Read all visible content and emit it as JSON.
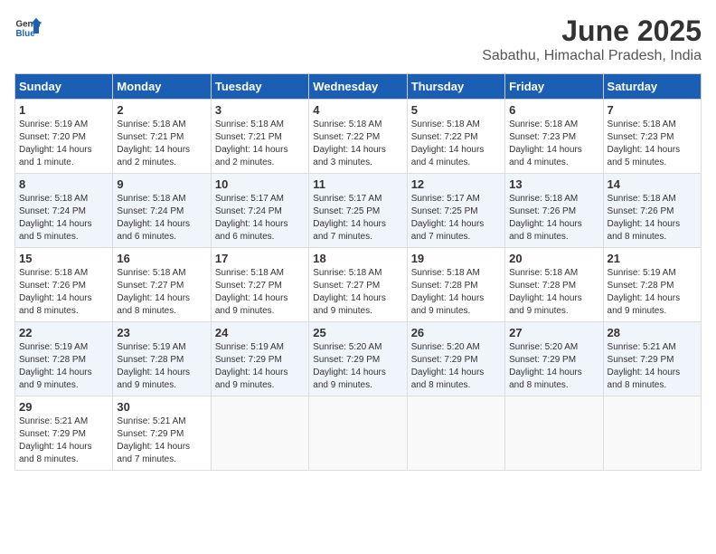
{
  "header": {
    "logo_general": "General",
    "logo_blue": "Blue",
    "month_title": "June 2025",
    "subtitle": "Sabathu, Himachal Pradesh, India"
  },
  "days_of_week": [
    "Sunday",
    "Monday",
    "Tuesday",
    "Wednesday",
    "Thursday",
    "Friday",
    "Saturday"
  ],
  "weeks": [
    [
      {
        "day": "1",
        "sunrise": "Sunrise: 5:19 AM",
        "sunset": "Sunset: 7:20 PM",
        "daylight": "Daylight: 14 hours and 1 minute."
      },
      {
        "day": "2",
        "sunrise": "Sunrise: 5:18 AM",
        "sunset": "Sunset: 7:21 PM",
        "daylight": "Daylight: 14 hours and 2 minutes."
      },
      {
        "day": "3",
        "sunrise": "Sunrise: 5:18 AM",
        "sunset": "Sunset: 7:21 PM",
        "daylight": "Daylight: 14 hours and 2 minutes."
      },
      {
        "day": "4",
        "sunrise": "Sunrise: 5:18 AM",
        "sunset": "Sunset: 7:22 PM",
        "daylight": "Daylight: 14 hours and 3 minutes."
      },
      {
        "day": "5",
        "sunrise": "Sunrise: 5:18 AM",
        "sunset": "Sunset: 7:22 PM",
        "daylight": "Daylight: 14 hours and 4 minutes."
      },
      {
        "day": "6",
        "sunrise": "Sunrise: 5:18 AM",
        "sunset": "Sunset: 7:23 PM",
        "daylight": "Daylight: 14 hours and 4 minutes."
      },
      {
        "day": "7",
        "sunrise": "Sunrise: 5:18 AM",
        "sunset": "Sunset: 7:23 PM",
        "daylight": "Daylight: 14 hours and 5 minutes."
      }
    ],
    [
      {
        "day": "8",
        "sunrise": "Sunrise: 5:18 AM",
        "sunset": "Sunset: 7:24 PM",
        "daylight": "Daylight: 14 hours and 5 minutes."
      },
      {
        "day": "9",
        "sunrise": "Sunrise: 5:18 AM",
        "sunset": "Sunset: 7:24 PM",
        "daylight": "Daylight: 14 hours and 6 minutes."
      },
      {
        "day": "10",
        "sunrise": "Sunrise: 5:17 AM",
        "sunset": "Sunset: 7:24 PM",
        "daylight": "Daylight: 14 hours and 6 minutes."
      },
      {
        "day": "11",
        "sunrise": "Sunrise: 5:17 AM",
        "sunset": "Sunset: 7:25 PM",
        "daylight": "Daylight: 14 hours and 7 minutes."
      },
      {
        "day": "12",
        "sunrise": "Sunrise: 5:17 AM",
        "sunset": "Sunset: 7:25 PM",
        "daylight": "Daylight: 14 hours and 7 minutes."
      },
      {
        "day": "13",
        "sunrise": "Sunrise: 5:18 AM",
        "sunset": "Sunset: 7:26 PM",
        "daylight": "Daylight: 14 hours and 8 minutes."
      },
      {
        "day": "14",
        "sunrise": "Sunrise: 5:18 AM",
        "sunset": "Sunset: 7:26 PM",
        "daylight": "Daylight: 14 hours and 8 minutes."
      }
    ],
    [
      {
        "day": "15",
        "sunrise": "Sunrise: 5:18 AM",
        "sunset": "Sunset: 7:26 PM",
        "daylight": "Daylight: 14 hours and 8 minutes."
      },
      {
        "day": "16",
        "sunrise": "Sunrise: 5:18 AM",
        "sunset": "Sunset: 7:27 PM",
        "daylight": "Daylight: 14 hours and 8 minutes."
      },
      {
        "day": "17",
        "sunrise": "Sunrise: 5:18 AM",
        "sunset": "Sunset: 7:27 PM",
        "daylight": "Daylight: 14 hours and 9 minutes."
      },
      {
        "day": "18",
        "sunrise": "Sunrise: 5:18 AM",
        "sunset": "Sunset: 7:27 PM",
        "daylight": "Daylight: 14 hours and 9 minutes."
      },
      {
        "day": "19",
        "sunrise": "Sunrise: 5:18 AM",
        "sunset": "Sunset: 7:28 PM",
        "daylight": "Daylight: 14 hours and 9 minutes."
      },
      {
        "day": "20",
        "sunrise": "Sunrise: 5:18 AM",
        "sunset": "Sunset: 7:28 PM",
        "daylight": "Daylight: 14 hours and 9 minutes."
      },
      {
        "day": "21",
        "sunrise": "Sunrise: 5:19 AM",
        "sunset": "Sunset: 7:28 PM",
        "daylight": "Daylight: 14 hours and 9 minutes."
      }
    ],
    [
      {
        "day": "22",
        "sunrise": "Sunrise: 5:19 AM",
        "sunset": "Sunset: 7:28 PM",
        "daylight": "Daylight: 14 hours and 9 minutes."
      },
      {
        "day": "23",
        "sunrise": "Sunrise: 5:19 AM",
        "sunset": "Sunset: 7:28 PM",
        "daylight": "Daylight: 14 hours and 9 minutes."
      },
      {
        "day": "24",
        "sunrise": "Sunrise: 5:19 AM",
        "sunset": "Sunset: 7:29 PM",
        "daylight": "Daylight: 14 hours and 9 minutes."
      },
      {
        "day": "25",
        "sunrise": "Sunrise: 5:20 AM",
        "sunset": "Sunset: 7:29 PM",
        "daylight": "Daylight: 14 hours and 9 minutes."
      },
      {
        "day": "26",
        "sunrise": "Sunrise: 5:20 AM",
        "sunset": "Sunset: 7:29 PM",
        "daylight": "Daylight: 14 hours and 8 minutes."
      },
      {
        "day": "27",
        "sunrise": "Sunrise: 5:20 AM",
        "sunset": "Sunset: 7:29 PM",
        "daylight": "Daylight: 14 hours and 8 minutes."
      },
      {
        "day": "28",
        "sunrise": "Sunrise: 5:21 AM",
        "sunset": "Sunset: 7:29 PM",
        "daylight": "Daylight: 14 hours and 8 minutes."
      }
    ],
    [
      {
        "day": "29",
        "sunrise": "Sunrise: 5:21 AM",
        "sunset": "Sunset: 7:29 PM",
        "daylight": "Daylight: 14 hours and 8 minutes."
      },
      {
        "day": "30",
        "sunrise": "Sunrise: 5:21 AM",
        "sunset": "Sunset: 7:29 PM",
        "daylight": "Daylight: 14 hours and 7 minutes."
      },
      {
        "day": "",
        "sunrise": "",
        "sunset": "",
        "daylight": ""
      },
      {
        "day": "",
        "sunrise": "",
        "sunset": "",
        "daylight": ""
      },
      {
        "day": "",
        "sunrise": "",
        "sunset": "",
        "daylight": ""
      },
      {
        "day": "",
        "sunrise": "",
        "sunset": "",
        "daylight": ""
      },
      {
        "day": "",
        "sunrise": "",
        "sunset": "",
        "daylight": ""
      }
    ]
  ]
}
